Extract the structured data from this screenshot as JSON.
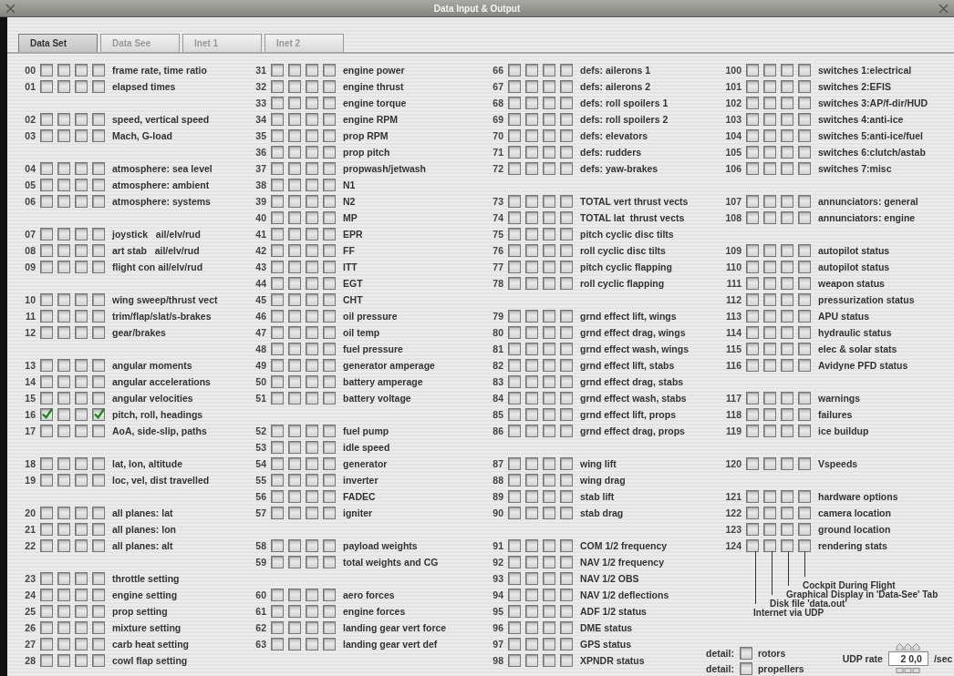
{
  "window": {
    "title": "Data Input & Output"
  },
  "tabs": [
    {
      "label": "Data Set",
      "selected": true
    },
    {
      "label": "Data See",
      "selected": false
    },
    {
      "label": "Inet 1",
      "selected": false
    },
    {
      "label": "Inet 2",
      "selected": false
    }
  ],
  "columns": [
    {
      "groups": [
        {
          "rows": [
            {
              "index": "00",
              "label": "frame rate, time ratio",
              "checks": [
                false,
                false,
                false,
                false
              ]
            },
            {
              "index": "01",
              "label": "elapsed times",
              "checks": [
                false,
                false,
                false,
                false
              ]
            }
          ]
        },
        {
          "rows": [
            {
              "index": "02",
              "label": "speed, vertical speed",
              "checks": [
                false,
                false,
                false,
                false
              ]
            },
            {
              "index": "03",
              "label": "Mach, G-load",
              "checks": [
                false,
                false,
                false,
                false
              ]
            }
          ]
        },
        {
          "rows": [
            {
              "index": "04",
              "label": "atmosphere: sea level",
              "checks": [
                false,
                false,
                false,
                false
              ]
            },
            {
              "index": "05",
              "label": "atmosphere: ambient",
              "checks": [
                false,
                false,
                false,
                false
              ]
            },
            {
              "index": "06",
              "label": "atmosphere: systems",
              "checks": [
                false,
                false,
                false,
                false
              ]
            }
          ]
        },
        {
          "rows": [
            {
              "index": "07",
              "label": "joystick   ail/elv/rud",
              "checks": [
                false,
                false,
                false,
                false
              ]
            },
            {
              "index": "08",
              "label": "art stab   ail/elv/rud",
              "checks": [
                false,
                false,
                false,
                false
              ]
            },
            {
              "index": "09",
              "label": "flight con ail/elv/rud",
              "checks": [
                false,
                false,
                false,
                false
              ]
            }
          ]
        },
        {
          "rows": [
            {
              "index": "10",
              "label": "wing sweep/thrust vect",
              "checks": [
                false,
                false,
                false,
                false
              ]
            },
            {
              "index": "11",
              "label": "trim/flap/slat/s-brakes",
              "checks": [
                false,
                false,
                false,
                false
              ]
            },
            {
              "index": "12",
              "label": "gear/brakes",
              "checks": [
                false,
                false,
                false,
                false
              ]
            }
          ]
        },
        {
          "rows": [
            {
              "index": "13",
              "label": "angular moments",
              "checks": [
                false,
                false,
                false,
                false
              ]
            },
            {
              "index": "14",
              "label": "angular accelerations",
              "checks": [
                false,
                false,
                false,
                false
              ]
            },
            {
              "index": "15",
              "label": "angular velocities",
              "checks": [
                false,
                false,
                false,
                false
              ]
            },
            {
              "index": "16",
              "label": "pitch, roll, headings",
              "checks": [
                true,
                false,
                false,
                true
              ]
            },
            {
              "index": "17",
              "label": "AoA, side-slip, paths",
              "checks": [
                false,
                false,
                false,
                false
              ]
            }
          ]
        },
        {
          "rows": [
            {
              "index": "18",
              "label": "lat, lon, altitude",
              "checks": [
                false,
                false,
                false,
                false
              ]
            },
            {
              "index": "19",
              "label": "loc, vel, dist travelled",
              "checks": [
                false,
                false,
                false,
                false
              ]
            }
          ]
        },
        {
          "rows": [
            {
              "index": "20",
              "label": "all planes: lat",
              "checks": [
                false,
                false,
                false,
                false
              ]
            },
            {
              "index": "21",
              "label": "all planes: lon",
              "checks": [
                false,
                false,
                false,
                false
              ]
            },
            {
              "index": "22",
              "label": "all planes: alt",
              "checks": [
                false,
                false,
                false,
                false
              ]
            }
          ]
        },
        {
          "rows": [
            {
              "index": "23",
              "label": "throttle setting",
              "checks": [
                false,
                false,
                false,
                false
              ]
            },
            {
              "index": "24",
              "label": "engine setting",
              "checks": [
                false,
                false,
                false,
                false
              ]
            },
            {
              "index": "25",
              "label": "prop setting",
              "checks": [
                false,
                false,
                false,
                false
              ]
            },
            {
              "index": "26",
              "label": "mixture setting",
              "checks": [
                false,
                false,
                false,
                false
              ]
            },
            {
              "index": "27",
              "label": "carb heat setting",
              "checks": [
                false,
                false,
                false,
                false
              ]
            },
            {
              "index": "28",
              "label": "cowl flap setting",
              "checks": [
                false,
                false,
                false,
                false
              ]
            }
          ]
        }
      ]
    },
    {
      "groups": [
        {
          "rows": [
            {
              "index": "31",
              "label": "engine power",
              "checks": [
                false,
                false,
                false,
                false
              ]
            },
            {
              "index": "32",
              "label": "engine thrust",
              "checks": [
                false,
                false,
                false,
                false
              ]
            },
            {
              "index": "33",
              "label": "engine torque",
              "checks": [
                false,
                false,
                false,
                false
              ]
            },
            {
              "index": "34",
              "label": "engine RPM",
              "checks": [
                false,
                false,
                false,
                false
              ]
            },
            {
              "index": "35",
              "label": "prop RPM",
              "checks": [
                false,
                false,
                false,
                false
              ]
            },
            {
              "index": "36",
              "label": "prop pitch",
              "checks": [
                false,
                false,
                false,
                false
              ]
            },
            {
              "index": "37",
              "label": "propwash/jetwash",
              "checks": [
                false,
                false,
                false,
                false
              ]
            },
            {
              "index": "38",
              "label": "N1",
              "checks": [
                false,
                false,
                false,
                false
              ]
            },
            {
              "index": "39",
              "label": "N2",
              "checks": [
                false,
                false,
                false,
                false
              ]
            },
            {
              "index": "40",
              "label": "MP",
              "checks": [
                false,
                false,
                false,
                false
              ]
            },
            {
              "index": "41",
              "label": "EPR",
              "checks": [
                false,
                false,
                false,
                false
              ]
            },
            {
              "index": "42",
              "label": "FF",
              "checks": [
                false,
                false,
                false,
                false
              ]
            },
            {
              "index": "43",
              "label": "ITT",
              "checks": [
                false,
                false,
                false,
                false
              ]
            },
            {
              "index": "44",
              "label": "EGT",
              "checks": [
                false,
                false,
                false,
                false
              ]
            },
            {
              "index": "45",
              "label": "CHT",
              "checks": [
                false,
                false,
                false,
                false
              ]
            },
            {
              "index": "46",
              "label": "oil pressure",
              "checks": [
                false,
                false,
                false,
                false
              ]
            },
            {
              "index": "47",
              "label": "oil temp",
              "checks": [
                false,
                false,
                false,
                false
              ]
            },
            {
              "index": "48",
              "label": "fuel pressure",
              "checks": [
                false,
                false,
                false,
                false
              ]
            },
            {
              "index": "49",
              "label": "generator amperage",
              "checks": [
                false,
                false,
                false,
                false
              ]
            },
            {
              "index": "50",
              "label": "battery amperage",
              "checks": [
                false,
                false,
                false,
                false
              ]
            },
            {
              "index": "51",
              "label": "battery voltage",
              "checks": [
                false,
                false,
                false,
                false
              ]
            }
          ]
        },
        {
          "rows": [
            {
              "index": "52",
              "label": "fuel pump",
              "checks": [
                false,
                false,
                false,
                false
              ]
            },
            {
              "index": "53",
              "label": "idle speed",
              "checks": [
                false,
                false,
                false,
                false
              ]
            },
            {
              "index": "54",
              "label": "generator",
              "checks": [
                false,
                false,
                false,
                false
              ]
            },
            {
              "index": "55",
              "label": "inverter",
              "checks": [
                false,
                false,
                false,
                false
              ]
            },
            {
              "index": "56",
              "label": "FADEC",
              "checks": [
                false,
                false,
                false,
                false
              ]
            },
            {
              "index": "57",
              "label": "igniter",
              "checks": [
                false,
                false,
                false,
                false
              ]
            }
          ]
        },
        {
          "rows": [
            {
              "index": "58",
              "label": "payload weights",
              "checks": [
                false,
                false,
                false,
                false
              ]
            },
            {
              "index": "59",
              "label": "total weights and CG",
              "checks": [
                false,
                false,
                false,
                false
              ]
            }
          ]
        },
        {
          "rows": [
            {
              "index": "60",
              "label": "aero forces",
              "checks": [
                false,
                false,
                false,
                false
              ]
            },
            {
              "index": "61",
              "label": "engine forces",
              "checks": [
                false,
                false,
                false,
                false
              ]
            },
            {
              "index": "62",
              "label": "landing gear vert force",
              "checks": [
                false,
                false,
                false,
                false
              ]
            },
            {
              "index": "63",
              "label": "landing gear vert def",
              "checks": [
                false,
                false,
                false,
                false
              ]
            }
          ]
        }
      ]
    },
    {
      "groups": [
        {
          "rows": [
            {
              "index": "66",
              "label": "defs: ailerons 1",
              "checks": [
                false,
                false,
                false,
                false
              ]
            },
            {
              "index": "67",
              "label": "defs: ailerons 2",
              "checks": [
                false,
                false,
                false,
                false
              ]
            },
            {
              "index": "68",
              "label": "defs: roll spoilers 1",
              "checks": [
                false,
                false,
                false,
                false
              ]
            },
            {
              "index": "69",
              "label": "defs: roll spoilers 2",
              "checks": [
                false,
                false,
                false,
                false
              ]
            },
            {
              "index": "70",
              "label": "defs: elevators",
              "checks": [
                false,
                false,
                false,
                false
              ]
            },
            {
              "index": "71",
              "label": "defs: rudders",
              "checks": [
                false,
                false,
                false,
                false
              ]
            },
            {
              "index": "72",
              "label": "defs: yaw-brakes",
              "checks": [
                false,
                false,
                false,
                false
              ]
            }
          ]
        },
        {
          "rows": [
            {
              "index": "73",
              "label": "TOTAL vert thrust vects",
              "checks": [
                false,
                false,
                false,
                false
              ]
            },
            {
              "index": "74",
              "label": "TOTAL lat  thrust vects",
              "checks": [
                false,
                false,
                false,
                false
              ]
            },
            {
              "index": "75",
              "label": "pitch cyclic disc tilts",
              "checks": [
                false,
                false,
                false,
                false
              ]
            },
            {
              "index": "76",
              "label": "roll cyclic disc tilts",
              "checks": [
                false,
                false,
                false,
                false
              ]
            },
            {
              "index": "77",
              "label": "pitch cyclic flapping",
              "checks": [
                false,
                false,
                false,
                false
              ]
            },
            {
              "index": "78",
              "label": "roll cyclic flapping",
              "checks": [
                false,
                false,
                false,
                false
              ]
            }
          ]
        },
        {
          "rows": [
            {
              "index": "79",
              "label": "grnd effect lift, wings",
              "checks": [
                false,
                false,
                false,
                false
              ]
            },
            {
              "index": "80",
              "label": "grnd effect drag, wings",
              "checks": [
                false,
                false,
                false,
                false
              ]
            },
            {
              "index": "81",
              "label": "grnd effect wash, wings",
              "checks": [
                false,
                false,
                false,
                false
              ]
            },
            {
              "index": "82",
              "label": "grnd effect lift, stabs",
              "checks": [
                false,
                false,
                false,
                false
              ]
            },
            {
              "index": "83",
              "label": "grnd effect drag, stabs",
              "checks": [
                false,
                false,
                false,
                false
              ]
            },
            {
              "index": "84",
              "label": "grnd effect wash, stabs",
              "checks": [
                false,
                false,
                false,
                false
              ]
            },
            {
              "index": "85",
              "label": "grnd effect lift, props",
              "checks": [
                false,
                false,
                false,
                false
              ]
            },
            {
              "index": "86",
              "label": "grnd effect drag, props",
              "checks": [
                false,
                false,
                false,
                false
              ]
            }
          ]
        },
        {
          "rows": [
            {
              "index": "87",
              "label": "wing lift",
              "checks": [
                false,
                false,
                false,
                false
              ]
            },
            {
              "index": "88",
              "label": "wing drag",
              "checks": [
                false,
                false,
                false,
                false
              ]
            },
            {
              "index": "89",
              "label": "stab lift",
              "checks": [
                false,
                false,
                false,
                false
              ]
            },
            {
              "index": "90",
              "label": "stab drag",
              "checks": [
                false,
                false,
                false,
                false
              ]
            }
          ]
        },
        {
          "rows": [
            {
              "index": "91",
              "label": "COM 1/2 frequency",
              "checks": [
                false,
                false,
                false,
                false
              ]
            },
            {
              "index": "92",
              "label": "NAV 1/2 frequency",
              "checks": [
                false,
                false,
                false,
                false
              ]
            },
            {
              "index": "93",
              "label": "NAV 1/2 OBS",
              "checks": [
                false,
                false,
                false,
                false
              ]
            },
            {
              "index": "94",
              "label": "NAV 1/2 deflections",
              "checks": [
                false,
                false,
                false,
                false
              ]
            },
            {
              "index": "95",
              "label": "ADF 1/2 status",
              "checks": [
                false,
                false,
                false,
                false
              ]
            },
            {
              "index": "96",
              "label": "DME status",
              "checks": [
                false,
                false,
                false,
                false
              ]
            },
            {
              "index": "97",
              "label": "GPS status",
              "checks": [
                false,
                false,
                false,
                false
              ]
            },
            {
              "index": "98",
              "label": "XPNDR status",
              "checks": [
                false,
                false,
                false,
                false
              ]
            }
          ]
        }
      ]
    },
    {
      "groups": [
        {
          "rows": [
            {
              "index": "100",
              "label": "switches 1:electrical",
              "checks": [
                false,
                false,
                false,
                false
              ]
            },
            {
              "index": "101",
              "label": "switches 2:EFIS",
              "checks": [
                false,
                false,
                false,
                false
              ]
            },
            {
              "index": "102",
              "label": "switches 3:AP/f-dir/HUD",
              "checks": [
                false,
                false,
                false,
                false
              ]
            },
            {
              "index": "103",
              "label": "switches 4:anti-ice",
              "checks": [
                false,
                false,
                false,
                false
              ]
            },
            {
              "index": "104",
              "label": "switches 5:anti-ice/fuel",
              "checks": [
                false,
                false,
                false,
                false
              ]
            },
            {
              "index": "105",
              "label": "switches 6:clutch/astab",
              "checks": [
                false,
                false,
                false,
                false
              ]
            },
            {
              "index": "106",
              "label": "switches 7:misc",
              "checks": [
                false,
                false,
                false,
                false
              ]
            }
          ]
        },
        {
          "rows": [
            {
              "index": "107",
              "label": "annunciators: general",
              "checks": [
                false,
                false,
                false,
                false
              ]
            },
            {
              "index": "108",
              "label": "annunciators: engine",
              "checks": [
                false,
                false,
                false,
                false
              ]
            }
          ]
        },
        {
          "rows": [
            {
              "index": "109",
              "label": "autopilot status",
              "checks": [
                false,
                false,
                false,
                false
              ]
            },
            {
              "index": "110",
              "label": "autopilot status",
              "checks": [
                false,
                false,
                false,
                false
              ]
            },
            {
              "index": "111",
              "label": "weapon status",
              "checks": [
                false,
                false,
                false,
                false
              ]
            },
            {
              "index": "112",
              "label": "pressurization status",
              "checks": [
                false,
                false,
                false,
                false
              ]
            },
            {
              "index": "113",
              "label": "APU status",
              "checks": [
                false,
                false,
                false,
                false
              ]
            },
            {
              "index": "114",
              "label": "hydraulic status",
              "checks": [
                false,
                false,
                false,
                false
              ]
            },
            {
              "index": "115",
              "label": "elec & solar stats",
              "checks": [
                false,
                false,
                false,
                false
              ]
            },
            {
              "index": "116",
              "label": "Avidyne PFD status",
              "checks": [
                false,
                false,
                false,
                false
              ]
            }
          ]
        },
        {
          "rows": [
            {
              "index": "117",
              "label": "warnings",
              "checks": [
                false,
                false,
                false,
                false
              ]
            },
            {
              "index": "118",
              "label": "failures",
              "checks": [
                false,
                false,
                false,
                false
              ]
            },
            {
              "index": "119",
              "label": "ice buildup",
              "checks": [
                false,
                false,
                false,
                false
              ]
            }
          ]
        },
        {
          "rows": [
            {
              "index": "120",
              "label": "Vspeeds",
              "checks": [
                false,
                false,
                false,
                false
              ]
            }
          ]
        },
        {
          "rows": [
            {
              "index": "121",
              "label": "hardware options",
              "checks": [
                false,
                false,
                false,
                false
              ]
            },
            {
              "index": "122",
              "label": "camera location",
              "checks": [
                false,
                false,
                false,
                false
              ]
            },
            {
              "index": "123",
              "label": "ground location",
              "checks": [
                false,
                false,
                false,
                false
              ]
            },
            {
              "index": "124",
              "label": "rendering stats",
              "checks": [
                false,
                false,
                false,
                false
              ]
            }
          ]
        }
      ]
    }
  ],
  "legend": [
    "Cockpit During Flight",
    "Graphical Display in 'Data-See' Tab",
    "Disk file 'data.out'",
    "Internet via UDP"
  ],
  "details": [
    {
      "label": "detail:",
      "name": "rotors",
      "checked": false
    },
    {
      "label": "detail:",
      "name": "propellers",
      "checked": false
    }
  ],
  "udp": {
    "label": "UDP rate",
    "value": "2 0,0",
    "unit": "/sec"
  }
}
